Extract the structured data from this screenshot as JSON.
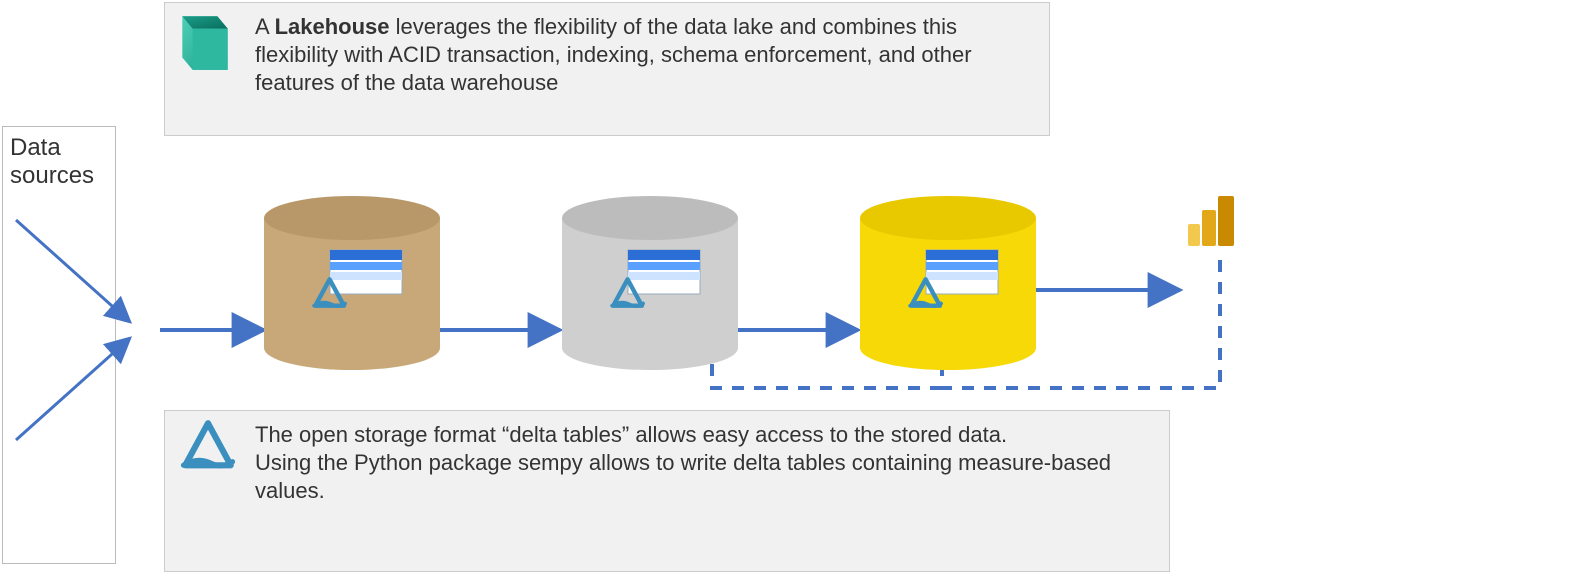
{
  "source_label": "Data sources",
  "callout_top_pre": "A ",
  "callout_top_bold": "Lakehouse",
  "callout_top_post": " leverages the flexibility of the data lake and combines this flexibility with ACID transaction, indexing, schema enforcement, and other features of the data warehouse",
  "callout_bottom_line1": "The open storage format “delta tables” allows easy access to the stored data.",
  "callout_bottom_line2": "Using the Python package sempy allows to write delta tables containing measure-based values.",
  "cylinders": [
    {
      "body": "#c8a878",
      "top": "#b89868"
    },
    {
      "body": "#cfcfcf",
      "top": "#bcbcbc"
    },
    {
      "body": "#f8d908",
      "top": "#e8c900"
    }
  ],
  "colors": {
    "arrow": "#4472c4"
  }
}
